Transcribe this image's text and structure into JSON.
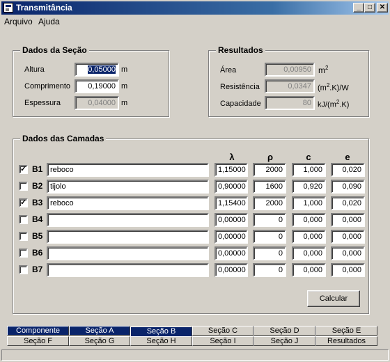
{
  "window": {
    "title": "Transmitância"
  },
  "menu": [
    "Arquivo",
    "Ajuda"
  ],
  "dados_secao": {
    "title": "Dados da Seção",
    "fields": [
      {
        "label": "Altura",
        "value": "0,05000",
        "unit": "m"
      },
      {
        "label": "Comprimento",
        "value": "0,19000",
        "unit": "m"
      },
      {
        "label": "Espessura",
        "value": "0,04000",
        "unit": "m"
      }
    ]
  },
  "resultados": {
    "title": "Resultados",
    "area": {
      "label": "Área",
      "value": "0,00950",
      "unit": "m",
      "unit_sup": "2"
    },
    "resistencia": {
      "label": "Resistência",
      "value": "0,0347",
      "unit_pre": "(m",
      "unit_sup": "2",
      "unit_post": ".K)/W"
    },
    "capacidade": {
      "label": "Capacidade",
      "value": "80",
      "unit_pre": "kJ/(m",
      "unit_sup": "2",
      "unit_post": ".K)"
    }
  },
  "camadas": {
    "title": "Dados das Camadas",
    "columns": [
      "λ",
      "ρ",
      "c",
      "e"
    ],
    "rows": [
      {
        "id": "B1",
        "checked": true,
        "name": "reboco",
        "lambda": "1,15000",
        "rho": "2000",
        "c": "1,000",
        "e": "0,020"
      },
      {
        "id": "B2",
        "checked": false,
        "name": "tijolo",
        "lambda": "0,90000",
        "rho": "1600",
        "c": "0,920",
        "e": "0,090"
      },
      {
        "id": "B3",
        "checked": true,
        "name": "reboco",
        "lambda": "1,15400",
        "rho": "2000",
        "c": "1,000",
        "e": "0,020"
      },
      {
        "id": "B4",
        "checked": false,
        "name": "",
        "lambda": "0,00000",
        "rho": "0",
        "c": "0,000",
        "e": "0,000"
      },
      {
        "id": "B5",
        "checked": false,
        "name": "",
        "lambda": "0,00000",
        "rho": "0",
        "c": "0,000",
        "e": "0,000"
      },
      {
        "id": "B6",
        "checked": false,
        "name": "",
        "lambda": "0,00000",
        "rho": "0",
        "c": "0,000",
        "e": "0,000"
      },
      {
        "id": "B7",
        "checked": false,
        "name": "",
        "lambda": "0,00000",
        "rho": "0",
        "c": "0,000",
        "e": "0,000"
      }
    ],
    "calc_button": "Calcular"
  },
  "tabs_row1": [
    "Componente",
    "Seção A",
    "Seção B",
    "Seção C",
    "Seção D",
    "Seção E"
  ],
  "tabs_row2": [
    "Seção F",
    "Seção G",
    "Seção H",
    "Seção I",
    "Seção J",
    "Resultados"
  ],
  "selected_tab": "Seção B",
  "colors": {
    "title_active": "#0a246a",
    "face": "#d4d0c8"
  }
}
